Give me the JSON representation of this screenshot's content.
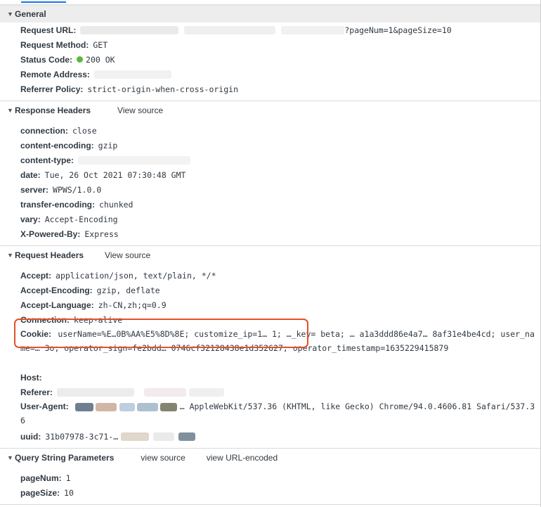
{
  "general": {
    "title": "General",
    "request_url_label": "Request URL:",
    "request_url_value": "?pageNum=1&pageSize=10",
    "request_method_label": "Request Method:",
    "request_method_value": "GET",
    "status_code_label": "Status Code:",
    "status_code_value": "200 OK",
    "remote_address_label": "Remote Address:",
    "referrer_policy_label": "Referrer Policy:",
    "referrer_policy_value": "strict-origin-when-cross-origin"
  },
  "response_headers": {
    "title": "Response Headers",
    "view_source": "View source",
    "rows": [
      {
        "key": "connection:",
        "value": "close"
      },
      {
        "key": "content-encoding:",
        "value": "gzip"
      },
      {
        "key": "content-type:",
        "value": ""
      },
      {
        "key": "date:",
        "value": "Tue, 26 Oct 2021 07:30:48 GMT"
      },
      {
        "key": "server:",
        "value": "WPWS/1.0.0"
      },
      {
        "key": "transfer-encoding:",
        "value": "chunked"
      },
      {
        "key": "vary:",
        "value": "Accept-Encoding"
      },
      {
        "key": "X-Powered-By:",
        "value": "Express"
      }
    ]
  },
  "request_headers": {
    "title": "Request Headers",
    "view_source": "View source",
    "accept_key": "Accept:",
    "accept_value": "application/json, text/plain, */*",
    "accept_encoding_key": "Accept-Encoding:",
    "accept_encoding_value": "gzip, deflate",
    "accept_language_key": "Accept-Language:",
    "accept_language_value": "zh-CN,zh;q=0.9",
    "connection_key": "Connection:",
    "connection_value": "keep-alive",
    "cookie_key": "Cookie:",
    "cookie_value": "userName=%E…0B%AA%E5%8D%8E; customize_ip=1… 1; …_key= beta; … a1a3ddd86e4a7… 8af31e4be4cd; user_name=… 3o; operator_sign=fe2bdd… 0746cf32128438e1d352627; operator_timestamp=1635229415879",
    "host_key": "Host:",
    "referer_key": "Referer:",
    "user_agent_key": "User-Agent:",
    "user_agent_value": "… AppleWebKit/537.36 (KHTML, like Gecko) Chrome/94.0.4606.81 Safari/537.36",
    "uuid_key": "uuid:",
    "uuid_value": "31b07978-3c71-…"
  },
  "query_string": {
    "title": "Query String Parameters",
    "view_source": "view source",
    "view_url_encoded": "view URL-encoded",
    "rows": [
      {
        "key": "pageNum:",
        "value": "1"
      },
      {
        "key": "pageSize:",
        "value": "10"
      }
    ]
  },
  "colors": {
    "status_ok": "#5bb73d",
    "annotation_box": "#e2502b",
    "tab_accent": "#1a73e8"
  },
  "icons": [
    "collapse-triangle-icon",
    "status-ok-dot-icon"
  ]
}
